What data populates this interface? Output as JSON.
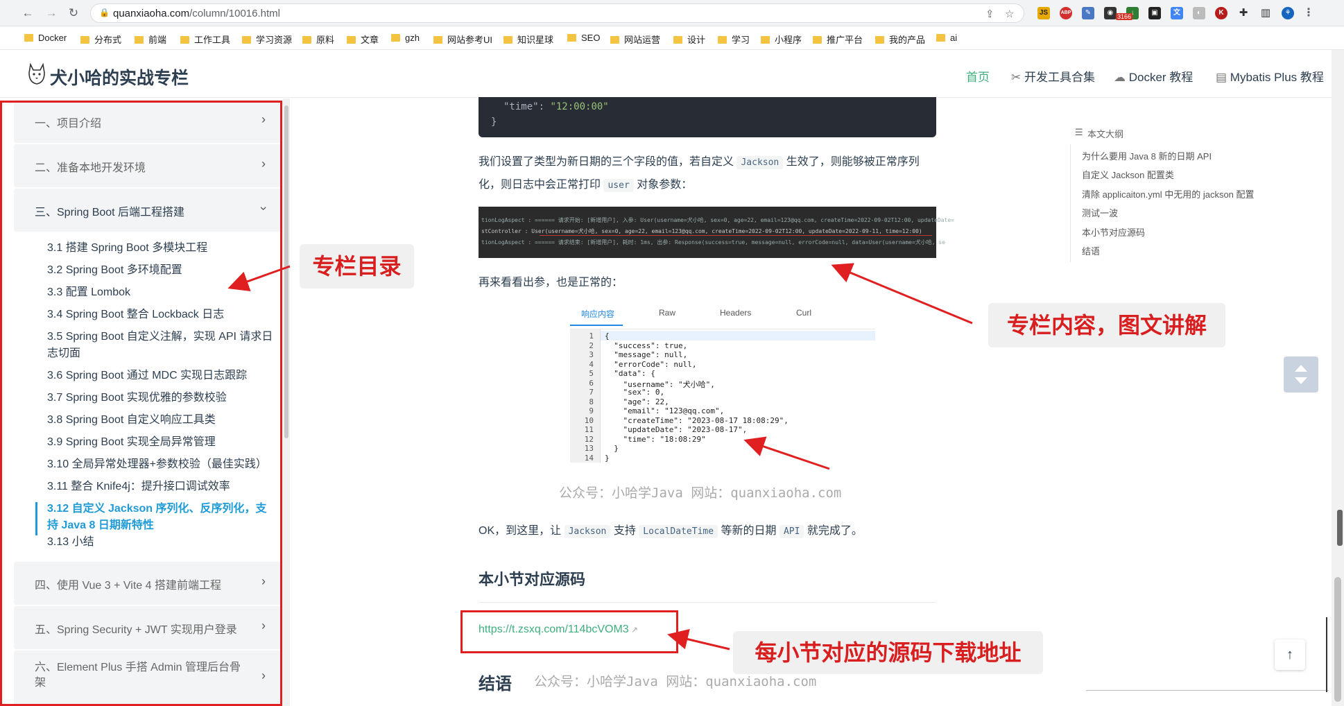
{
  "browser": {
    "url_host": "quanxiaoha.com",
    "url_path": "/column/10016.html",
    "ext_badge": "3166",
    "bookmarks": [
      "Docker",
      "分布式",
      "前端",
      "工作工具",
      "学习资源",
      "原料",
      "文章",
      "gzh",
      "网站参考UI",
      "知识星球",
      "SEO",
      "网站运营",
      "设计",
      "学习",
      "小程序",
      "推广平台",
      "我的产品",
      "ai"
    ]
  },
  "site": {
    "title": "犬小哈的实战专栏",
    "nav": [
      "首页",
      "开发工具合集",
      "Docker 教程",
      "Mybatis Plus 教程"
    ]
  },
  "sidebar": {
    "groups": [
      "一、项目介绍",
      "二、准备本地开发环境",
      "三、Spring Boot 后端工程搭建",
      "四、使用 Vue 3 + Vite 4 搭建前端工程",
      "五、Spring Security + JWT 实现用户登录",
      "六、Element Plus 手搭 Admin 管理后台骨架"
    ],
    "subitems": [
      "3.1 搭建 Spring Boot 多模块工程",
      "3.2 Spring Boot 多环境配置",
      "3.3 配置 Lombok",
      "3.4 Spring Boot 整合 Lockback 日志",
      "3.5 Spring Boot 自定义注解，实现 API 请求日志切面",
      "3.6 Spring Boot 通过 MDC 实现日志跟踪",
      "3.7 Spring Boot 实现优雅的参数校验",
      "3.8 Spring Boot 自定义响应工具类",
      "3.9 Spring Boot 实现全局异常管理",
      "3.10 全局异常处理器+参数校验（最佳实践）",
      "3.11 整合 Knife4j：提升接口调试效率",
      "3.12 自定义 Jackson 序列化、反序列化，支持 Java 8 日期新特性",
      "3.13 小结"
    ]
  },
  "content": {
    "code_top": {
      "key": "\"time\"",
      "colon": ": ",
      "value": "\"12:00:00\"",
      "close": "}"
    },
    "para1_a": "我们设置了类型为新日期的三个字段的值，若自定义",
    "para1_code1": "Jackson",
    "para1_b": "生效了，则能够被正常序列化，则日志中会正常打印",
    "para1_code2": "user",
    "para1_c": "对象参数：",
    "log_lines": [
      "tionLogAspect     : ====== 请求开始: [新增用户], 入参: User(username=犬小哈, sex=0, age=22, email=123@qq.com, createTime=2022-09-02T12:00, updateDate=",
      "stController      : User(username=犬小哈, sex=0, age=22, email=123@qq.com, createTime=2022-09-02T12:00, updateDate=2022-09-11, time=12:00)",
      "tionLogAspect     : ====== 请求结束: [新增用户], 耗时: 1ms, 出参: Response(success=true, message=null, errorCode=null, data=User(username=犬小哈, se"
    ],
    "para2": "再来看看出参，也是正常的：",
    "resp_tabs": [
      "响应内容",
      "Raw",
      "Headers",
      "Curl"
    ],
    "resp_lines": [
      "{",
      "  \"success\": true,",
      "  \"message\": null,",
      "  \"errorCode\": null,",
      "  \"data\": {",
      "    \"username\": \"犬小哈\",",
      "    \"sex\": 0,",
      "    \"age\": 22,",
      "    \"email\": \"123@qq.com\",",
      "    \"createTime\": \"2023-08-17 18:08:29\",",
      "    \"updateDate\": \"2023-08-17\",",
      "    \"time\": \"18:08:29\"",
      "  }",
      "}"
    ],
    "resp_linenos": [
      "1",
      "2",
      "3",
      "4",
      "5",
      "6",
      "7",
      "8",
      "9",
      "10",
      "11",
      "12",
      "13",
      "14"
    ],
    "watermark": "公众号：小哈学Java 网站：quanxiaoha.com",
    "para3_a": "OK，到这里，让",
    "para3_code1": "Jackson",
    "para3_b": "支持",
    "para3_code2": "LocalDateTime",
    "para3_c": "等新的日期",
    "para3_code3": "API",
    "para3_d": "就完成了。",
    "section_heading": "本小节对应源码",
    "source_link": "https://t.zsxq.com/114bcVOM3",
    "end_heading": "结语"
  },
  "toc": {
    "title": "本文大纲",
    "items": [
      "为什么要用 Java 8 新的日期 API",
      "自定义 Jackson 配置类",
      "清除 applicaiton.yml 中无用的 jackson 配置",
      "测试一波",
      "本小节对应源码",
      "结语"
    ]
  },
  "callouts": {
    "catalog": "专栏目录",
    "content": "专栏内容，图文讲解",
    "source": "每小节对应的源码下载地址"
  },
  "colors": {
    "accent": "#3eaf7c",
    "active_link": "#1e9bd7",
    "annotation_red": "#e02020"
  }
}
